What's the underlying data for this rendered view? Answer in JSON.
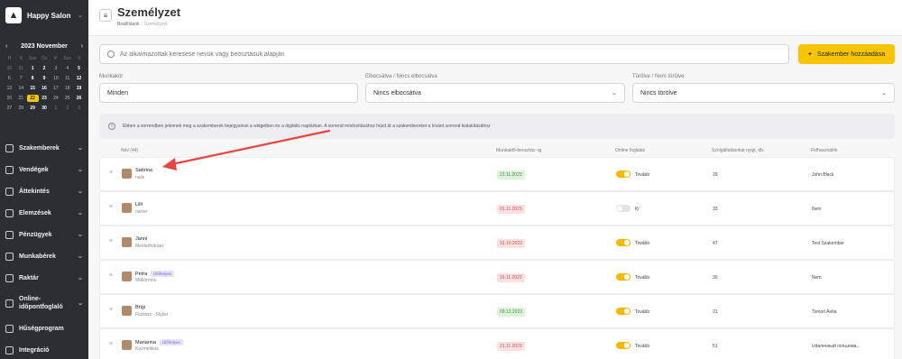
{
  "sidebar": {
    "brand": "Happy Salon",
    "calendar": {
      "month_label": "2023 November",
      "weekdays": [
        "H",
        "K",
        "Sze",
        "Cs",
        "P",
        "Szo",
        "V"
      ],
      "days": [
        [
          "30",
          "31",
          "1",
          "2",
          "3",
          "4",
          "5"
        ],
        [
          "6",
          "7",
          "8",
          "9",
          "10",
          "11",
          "12"
        ],
        [
          "13",
          "14",
          "15",
          "16",
          "17",
          "18",
          "19"
        ],
        [
          "20",
          "21",
          "22",
          "23",
          "24",
          "25",
          "26"
        ],
        [
          "27",
          "28",
          "29",
          "30",
          "1",
          "2",
          "3"
        ]
      ],
      "today": "22"
    },
    "items": [
      {
        "label": "Szakemberek"
      },
      {
        "label": "Vendégek"
      },
      {
        "label": "Áttekintés"
      },
      {
        "label": "Elemzések"
      },
      {
        "label": "Pénzügyek"
      },
      {
        "label": "Munkabérek"
      },
      {
        "label": "Raktár"
      },
      {
        "label": "Online-időpontfoglaló"
      },
      {
        "label": "Hűségprogram"
      },
      {
        "label": "Integráció"
      }
    ]
  },
  "header": {
    "title": "Személyzet",
    "breadcrumb": [
      "Beállítások",
      "Személyzet"
    ]
  },
  "search": {
    "placeholder": "Az alkalmazottak keresése nevük vagy beosztásuk alapján"
  },
  "add_button": {
    "label": "Szakember hozzáadása",
    "color": "#f7c600"
  },
  "filters": [
    {
      "label": "Munkakör",
      "value": "Minden"
    },
    {
      "label": "Elbocsátva / Nincs elbocsátva",
      "value": "Nincs elbocsátva"
    },
    {
      "label": "Törölve / Nem törölve",
      "value": "Nincs törölve"
    }
  ],
  "info": {
    "text": "Ebben a sorrendben jelennek meg a szakemberek bejegyzései a widgetben és a digitális naptárban. A sorrend módosításához húzd át a szakembereket a kívánt sorrend kialakításához"
  },
  "table": {
    "headers": {
      "name": "Név (44)",
      "schedule": "Munkaidő-beosztás -ig",
      "online": "Online foglalás",
      "services": "Szolgáltatásokat nyújt, db.",
      "user": "Felhasználók"
    },
    "rows": [
      {
        "name": "Sabrina",
        "role": "nails",
        "tag": "",
        "date": "23.11.2023",
        "date_status": "green",
        "online": true,
        "online_label": "Tovább",
        "services": "29",
        "user": "John Black"
      },
      {
        "name": "Lilli",
        "role": "owner",
        "tag": "",
        "date": "01.11.2023",
        "date_status": "red",
        "online": false,
        "online_label": "Ki",
        "services": "33",
        "user": "Nem"
      },
      {
        "name": "Janni",
        "role": "Mesterfodrász",
        "tag": "",
        "date": "31.10.2023",
        "date_status": "red",
        "online": true,
        "online_label": "Tovább",
        "services": "47",
        "user": "Test Szakember"
      },
      {
        "name": "Petra",
        "role": "Műkörmös",
        "tag": "Ülőhelyes",
        "date": "16.11.2023",
        "date_status": "red",
        "online": true,
        "online_label": "Tovább",
        "services": "30",
        "user": "Nem"
      },
      {
        "name": "Brigi",
        "role": "Fodrász - Stylist",
        "tag": "",
        "date": "09.12.2023",
        "date_status": "green",
        "online": true,
        "online_label": "Tovább",
        "services": "21",
        "user": "Tomori Anita"
      },
      {
        "name": "Marianna",
        "role": "Kozmetikus",
        "tag": "Ülőhelyes",
        "date": "21.11.2023",
        "date_status": "red",
        "online": true,
        "online_label": "Tovább",
        "services": "51",
        "user": "Udaленный пользова..."
      }
    ]
  }
}
